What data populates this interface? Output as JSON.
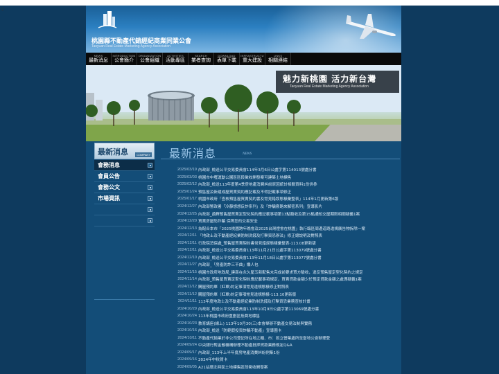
{
  "corner_glyph": "◇",
  "association": {
    "name_zh": "桃園縣不動產代銷經紀商業同業公會",
    "name_en": "Taoyuan Real Estate Marketing Agency Association"
  },
  "nav": [
    {
      "en": "NEWS",
      "zh": "最新消息"
    },
    {
      "en": "INTRODUCTION",
      "zh": "公會簡介"
    },
    {
      "en": "ORGANIZATION",
      "zh": "公會組織"
    },
    {
      "en": "ACTIVITIES",
      "zh": "活動專區"
    },
    {
      "en": "SEARCH",
      "zh": "業者查詢"
    },
    {
      "en": "DOWNLOAD",
      "zh": "表單下載"
    },
    {
      "en": "INFRASTRUCTU",
      "zh": "重大建設"
    },
    {
      "en": "LINKS",
      "zh": "相關連結"
    }
  ],
  "hero": {
    "slogan_zh": "魅力新桃園  活力新台灣",
    "slogan_en": "Taoyuan Real Estate Marketing Agency Association"
  },
  "sidebar": {
    "title_zh": "最新消息",
    "title_en": "COMPANY",
    "items": [
      {
        "label": "會務消息"
      },
      {
        "label": "會員公告"
      },
      {
        "label": "會務公文"
      },
      {
        "label": "市場資訊"
      },
      {
        "label": ""
      },
      {
        "label": ""
      }
    ]
  },
  "main": {
    "title_zh": "最新消息",
    "title_en": "NEWS",
    "news": [
      {
        "date": "2025/03/19",
        "title": "內政部_檢送公平交易委員會114年3月6日公處字第114013號處分書"
      },
      {
        "date": "2025/03/03",
        "title": "桃園市中壢運動公園區區段徵收開發案可建築土地標售"
      },
      {
        "date": "2025/02/12",
        "title": "內政部_檢送113年度第4季房地產消費糾紛原因統計相關資料1份供參"
      },
      {
        "date": "2025/01/24",
        "title": "預售屋及新建成屋買賣契約應記載及不得記載事項修正"
      },
      {
        "date": "2025/01/17",
        "title": "桃園市政府「查核預售屋買賣契約書及常見錯誤態樣彙整表」114年1月更新第6版"
      },
      {
        "date": "2024/12/27",
        "title": "內政部警政署「冷靜想想反詐系列」及「詐騙套路來解密系列」宣導影片"
      },
      {
        "date": "2024/12/25",
        "title": "內政部_函釋預售屋買賣定型化契約應記載事項第13點驗收及第15點通知交屋期限相關疑義1案"
      },
      {
        "date": "2024/12/20",
        "title": "買賣房屋防詐騙 保障您的交易安全"
      },
      {
        "date": "2024/12/13",
        "title": "為配合本市「2025桃園跨年晚會及2025台灣燈會在桃園」執行臨區周邊道路違規廣告物拆除一案"
      },
      {
        "date": "2024/12/11",
        "title": "「地政士及不動產經紀業防制洗錢及打擊資恐辦法」修正總說明及對照表"
      },
      {
        "date": "2024/12/11",
        "title": "行政院消保處_預售屋買賣契約書常見錯誤態樣彙整表-113.08更新版"
      },
      {
        "date": "2024/12/11",
        "title": "內政部_檢送公平交易委員會113年11月21日公處字第113079號處分書"
      },
      {
        "date": "2024/12/10",
        "title": "內政部_檢送公平交易委員會113年11月18日公處字第113077號處分書"
      },
      {
        "date": "2024/11/27",
        "title": "內政部_「房產防詐三不曲」懶人包"
      },
      {
        "date": "2024/11/15",
        "title": "桃園市政府地政局_建商在永久屋五新配售未完成前要求買方驗收，違反預售屋定型化契約之規定"
      },
      {
        "date": "2024/11/14",
        "title": "內政部_預售屋買賣定型化契約應記載事項規定，買賣貸款金額少於預定貸款金額之處理疑義1案"
      },
      {
        "date": "2024/11/12",
        "title": "購屋預約單（紅單)約定事項常見違規態樣修正對照表"
      },
      {
        "date": "2024/11/12",
        "title": "購屋預約單（紅單)約定事項常見違規態樣-113.10更新版"
      },
      {
        "date": "2024/11/11",
        "title": "113年度地政士及不動產經紀業防制洗錢及打擊資恐業務查核計畫"
      },
      {
        "date": "2024/10/29",
        "title": "內政部_檢送公平交易委員會113年10月9日公處字第113069號處分書"
      },
      {
        "date": "2024/10/24",
        "title": "113年桃園市政府重劃區抵費地標售"
      },
      {
        "date": "2024/10/23",
        "title": "教育講座(線上) 113年10月30(三)本會舉辦不動產交易法制與實務"
      },
      {
        "date": "2024/10/16",
        "title": "內政部_檢送「防範假投資詐騙不動產」宣導圖卡"
      },
      {
        "date": "2024/10/11",
        "title": "不動產代銷業於非公司登記所在地之櫃、市：設立營業處所至當地公會辦理登"
      },
      {
        "date": "2024/09/24",
        "title": "中央銀行對金融機構辦理不動產抵押貸款業務規定Q&A"
      },
      {
        "date": "2024/09/17",
        "title": "內政部_113年上半年度房地產消費糾紛例集1份"
      },
      {
        "date": "2024/09/16",
        "title": "2024年中秋賀卡"
      },
      {
        "date": "2024/09/05",
        "title": "A21站環北特區土地標售區段徵收開發案"
      }
    ]
  },
  "colors": {
    "page_bg": "#0e3a5e",
    "content_bg": "#134d78",
    "nav_bg": "#0a0a0a",
    "heading": "#9cc7ea"
  },
  "icons": [
    "logo-icon",
    "airplane-icon",
    "square-bullet-icon"
  ]
}
